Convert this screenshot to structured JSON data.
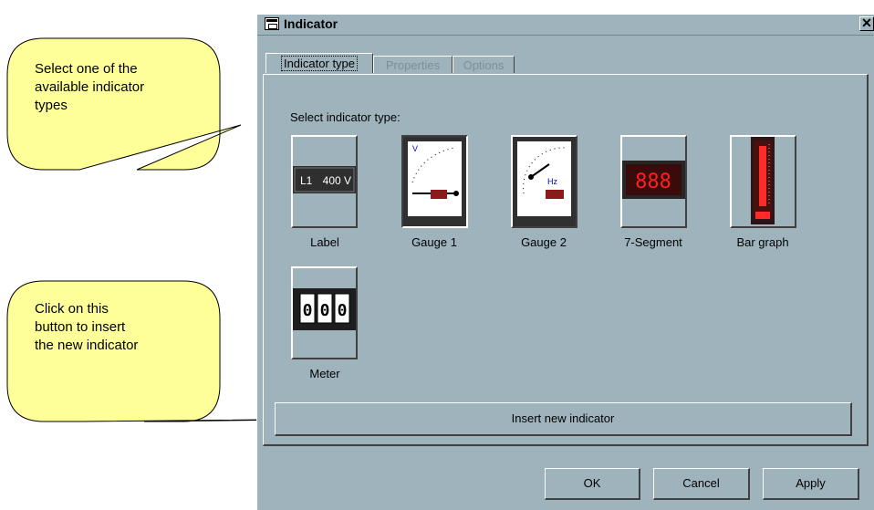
{
  "window": {
    "title": "Indicator",
    "close_glyph": "✕"
  },
  "tabs": [
    {
      "label": "Indicator type",
      "state": "active"
    },
    {
      "label": "Properties",
      "state": "disabled"
    },
    {
      "label": "Options",
      "state": "disabled"
    }
  ],
  "panel": {
    "select_label": "Select indicator type:",
    "indicators": [
      {
        "label": "Label",
        "preview_text_left": "L1",
        "preview_text_right": "400 V",
        "icon": "label-display-icon"
      },
      {
        "label": "Gauge 1",
        "unit": "V",
        "icon": "gauge-linear-icon",
        "selected": true
      },
      {
        "label": "Gauge 2",
        "unit": "Hz",
        "icon": "gauge-radial-icon"
      },
      {
        "label": "7-Segment",
        "preview_text": "888",
        "icon": "seven-segment-icon"
      },
      {
        "label": "Bar graph",
        "icon": "bar-graph-icon"
      },
      {
        "label": "Meter",
        "preview_digits": [
          "0",
          "0",
          "0"
        ],
        "icon": "counter-meter-icon"
      }
    ],
    "insert_button": "Insert new indicator"
  },
  "buttons": {
    "ok": "OK",
    "cancel": "Cancel",
    "apply": "Apply"
  },
  "callouts": [
    {
      "text_lines": [
        "Select one of the",
        "available indicator",
        "types"
      ]
    },
    {
      "text_lines": [
        "Click on this",
        "button to insert",
        "the new indicator"
      ]
    }
  ],
  "colors": {
    "dialog_bg": "#9fb3bd",
    "callout_fill": "#ffff99",
    "segment_red": "#ff2020",
    "display_dark": "#333333"
  }
}
